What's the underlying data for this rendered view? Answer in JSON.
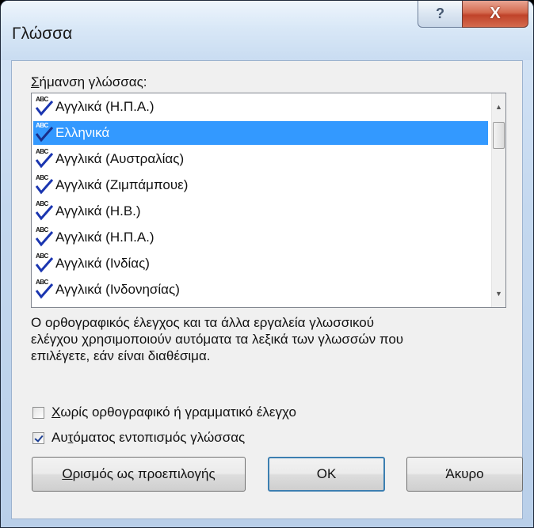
{
  "window": {
    "title": "Γλώσσα",
    "help_glyph": "?",
    "close_glyph": "X"
  },
  "language_label": {
    "accel": "Σ",
    "rest": "ήμανση γλώσσας:"
  },
  "languages": [
    {
      "label": "Αγγλικά (Η.Π.Α.)",
      "selected": false
    },
    {
      "label": "Ελληνικά",
      "selected": true
    },
    {
      "label": "Αγγλικά (Αυστραλίας)",
      "selected": false
    },
    {
      "label": "Αγγλικά (Ζιμπάμπουε)",
      "selected": false
    },
    {
      "label": "Αγγλικά (Η.Β.)",
      "selected": false
    },
    {
      "label": "Αγγλικά (Η.Π.Α.)",
      "selected": false
    },
    {
      "label": "Αγγλικά (Ινδίας)",
      "selected": false
    },
    {
      "label": "Αγγλικά (Ινδονησίας)",
      "selected": false
    }
  ],
  "spell_icon_text": "ABC",
  "scrollbar": {
    "up": "▲",
    "down": "▼"
  },
  "description": [
    "Ο ορθογραφικός έλεγχος και τα άλλα εργαλεία γλωσσικού",
    "ελέγχου χρησιμοποιούν αυτόματα τα λεξικά των γλωσσών που",
    "επιλέγετε, εάν είναι διαθέσιμα."
  ],
  "options": {
    "no_proofing": {
      "accel": "Χ",
      "rest": "ωρίς ορθογραφικό ή γραμματικό έλεγχο",
      "checked": false
    },
    "detect_language": {
      "pre": "Αυ",
      "accel": "τ",
      "rest": "όματος εντοπισμός γλώσσας",
      "checked": true
    }
  },
  "buttons": {
    "set_default": {
      "accel": "Ο",
      "rest": "ρισμός ως προεπιλογής"
    },
    "ok": "OK",
    "cancel": "Άκυρο"
  },
  "colors": {
    "selection": "#3399ff",
    "checkmark": "#1c3f94",
    "close_button": "#c0432a"
  }
}
